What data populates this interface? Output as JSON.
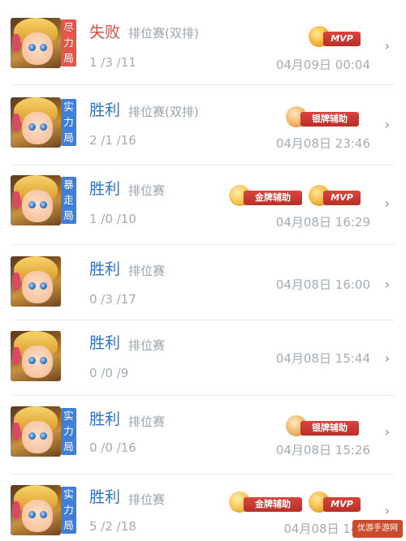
{
  "matches": [
    {
      "mode_label": "尽力局",
      "mode_color": "red",
      "result": "失败",
      "result_kind": "lose",
      "rank_type": "排位赛(双排)",
      "kda": "1 /3 /11",
      "time": "04月09日 00:04",
      "badges": [
        {
          "kind": "mvp",
          "label": "MVP"
        }
      ]
    },
    {
      "mode_label": "实力局",
      "mode_color": "blue",
      "result": "胜利",
      "result_kind": "win",
      "rank_type": "排位赛(双排)",
      "kda": "2 /1 /16",
      "time": "04月08日 23:46",
      "badges": [
        {
          "kind": "silver",
          "label": "银牌辅助"
        }
      ]
    },
    {
      "mode_label": "暴走局",
      "mode_color": "blue",
      "result": "胜利",
      "result_kind": "win",
      "rank_type": "排位赛",
      "kda": "1 /0 /10",
      "time": "04月08日 16:29",
      "badges": [
        {
          "kind": "gold",
          "label": "金牌辅助"
        },
        {
          "kind": "mvp",
          "label": "MVP"
        }
      ]
    },
    {
      "mode_label": "",
      "mode_color": "",
      "result": "胜利",
      "result_kind": "win",
      "rank_type": "排位赛",
      "kda": "0 /3 /17",
      "time": "04月08日 16:00",
      "badges": []
    },
    {
      "mode_label": "",
      "mode_color": "",
      "result": "胜利",
      "result_kind": "win",
      "rank_type": "排位赛",
      "kda": "0 /0 /9",
      "time": "04月08日 15:44",
      "badges": []
    },
    {
      "mode_label": "实力局",
      "mode_color": "blue",
      "result": "胜利",
      "result_kind": "win",
      "rank_type": "排位赛",
      "kda": "0 /0 /16",
      "time": "04月08日 15:26",
      "badges": [
        {
          "kind": "silver",
          "label": "银牌辅助"
        }
      ]
    },
    {
      "mode_label": "实力局",
      "mode_color": "blue",
      "result": "胜利",
      "result_kind": "win",
      "rank_type": "排位赛",
      "kda": "5 /2 /18",
      "time": "04月08日 14:3",
      "badges": [
        {
          "kind": "gold",
          "label": "金牌辅助"
        },
        {
          "kind": "mvp",
          "label": "MVP"
        }
      ]
    }
  ],
  "icons": {
    "row_chevron": "chevron-right-icon"
  },
  "watermark": {
    "text": "优游手游网"
  }
}
